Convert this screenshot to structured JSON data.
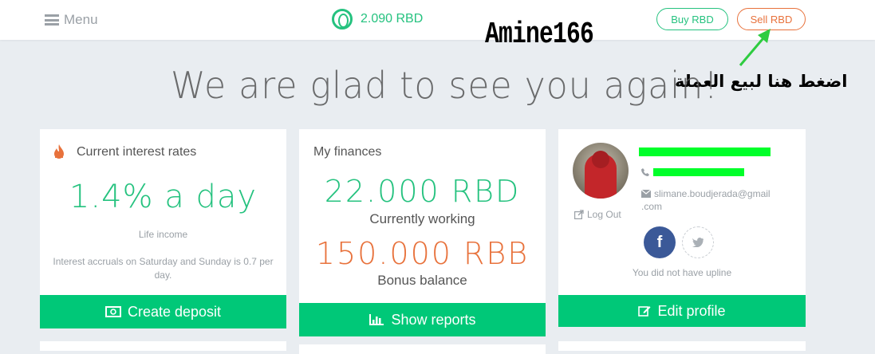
{
  "topbar": {
    "menu_label": "Menu",
    "balance": "2.090 RBD",
    "buy_label": "Buy RBD",
    "sell_label": "Sell RBD"
  },
  "annotation": {
    "username": "Amine166",
    "arabic_note": "اضغط هنا لبيع العملة",
    "arrow_color": "#2ecc40"
  },
  "welcome": "We are glad to see you again!",
  "interest_card": {
    "title": "Current interest rates",
    "icon": "fire-icon",
    "rate": "1.4% a day",
    "life_income": "Life income",
    "note": "Interest accruals on Saturday and Sunday is 0.7 per day.",
    "button_label": "Create deposit",
    "button_icon": "money-icon"
  },
  "finances_card": {
    "title": "My finances",
    "working_amount": "22.000 RBD",
    "working_label": "Currently working",
    "bonus_amount": "150.000 RBB",
    "bonus_label": "Bonus balance",
    "button_label": "Show reports",
    "button_icon": "bar-chart-icon"
  },
  "profile_card": {
    "email_line1": "slimane.boudjerada@gmail",
    "email_line2": ".com",
    "logout_label": "Log Out",
    "upline_note": "You did not have upline",
    "button_label": "Edit profile",
    "button_icon": "edit-icon"
  },
  "colors": {
    "accent_green": "#25c27f",
    "button_green": "#00c878",
    "accent_orange": "#e8723c",
    "facebook": "#3b5998",
    "redaction": "#00ff2a"
  }
}
